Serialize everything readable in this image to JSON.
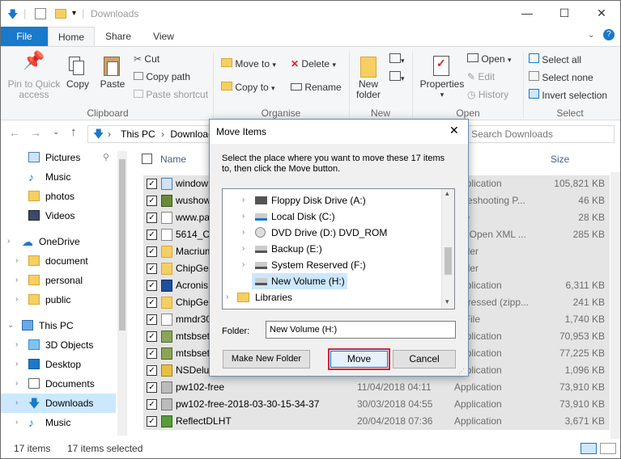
{
  "window": {
    "title": "Downloads",
    "min": "—",
    "max": "☐",
    "close": "✕"
  },
  "tabs": {
    "file": "File",
    "home": "Home",
    "share": "Share",
    "view": "View"
  },
  "ribbon": {
    "pin": "Pin to Quick access",
    "copy": "Copy",
    "paste": "Paste",
    "cut": "Cut",
    "copy_path": "Copy path",
    "paste_shortcut": "Paste shortcut",
    "clipboard": "Clipboard",
    "move_to": "Move to",
    "copy_to": "Copy to",
    "delete": "Delete",
    "rename": "Rename",
    "organise": "Organise",
    "new_folder": "New folder",
    "new": "New",
    "properties": "Properties",
    "open_btn": "Open",
    "edit": "Edit",
    "history": "History",
    "open_grp": "Open",
    "select_all": "Select all",
    "select_none": "Select none",
    "invert": "Invert selection",
    "select": "Select"
  },
  "nav": {
    "path_root": "This PC",
    "path_sep": "›",
    "path_current": "Downloads",
    "search_placeholder": "Search Downloads"
  },
  "sidebar": {
    "items": [
      {
        "label": "Pictures"
      },
      {
        "label": "Music"
      },
      {
        "label": "photos"
      },
      {
        "label": "Videos"
      },
      {
        "label": "OneDrive"
      },
      {
        "label": "document"
      },
      {
        "label": "personal"
      },
      {
        "label": "public"
      },
      {
        "label": "This PC"
      },
      {
        "label": "3D Objects"
      },
      {
        "label": "Desktop"
      },
      {
        "label": "Documents"
      },
      {
        "label": "Downloads"
      },
      {
        "label": "Music"
      }
    ]
  },
  "columns": {
    "name": "Name",
    "size": "Size"
  },
  "files": [
    {
      "name": "window",
      "date": "",
      "type": "Application",
      "size": "105,821 KB"
    },
    {
      "name": "wushow",
      "date": "",
      "type": "ubleshooting P...",
      "size": "46 KB"
    },
    {
      "name": "www.pa",
      "date": "",
      "type": "File",
      "size": "28 KB"
    },
    {
      "name": "5614_Cr",
      "date": "",
      "type": "ice Open XML ...",
      "size": "285 KB"
    },
    {
      "name": "Macrium",
      "date": "",
      "type": "folder",
      "size": ""
    },
    {
      "name": "ChipGen",
      "date": "",
      "type": "folder",
      "size": ""
    },
    {
      "name": "Acronis",
      "date": "",
      "type": "Application",
      "size": "6,311 KB"
    },
    {
      "name": "ChipGen",
      "date": "",
      "type": "mpressed (zipp...",
      "size": "241 KB"
    },
    {
      "name": "mmdr30",
      "date": "",
      "type": "G File",
      "size": "1,740 KB"
    },
    {
      "name": "mtsbset",
      "date": "",
      "type": "Application",
      "size": "70,953 KB"
    },
    {
      "name": "mtsbset",
      "date": "",
      "type": "Application",
      "size": "77,225 KB"
    },
    {
      "name": "NSDelux",
      "date": "",
      "type": "Application",
      "size": "1,096 KB"
    },
    {
      "name": "pw102-free",
      "date": "11/04/2018 04:11",
      "type": "Application",
      "size": "73,910 KB"
    },
    {
      "name": "pw102-free-2018-03-30-15-34-37",
      "date": "30/03/2018 04:55",
      "type": "Application",
      "size": "73,910 KB"
    },
    {
      "name": "ReflectDLHT",
      "date": "20/04/2018 07:36",
      "type": "Application",
      "size": "3,671 KB"
    }
  ],
  "status": {
    "count": "17 items",
    "selected": "17 items selected"
  },
  "dialog": {
    "title": "Move Items",
    "instruction": "Select the place where you want to move these 17 items to, then click the Move button.",
    "tree": [
      {
        "label": "Floppy Disk Drive (A:)"
      },
      {
        "label": "Local Disk (C:)"
      },
      {
        "label": "DVD Drive (D:) DVD_ROM"
      },
      {
        "label": "Backup (E:)"
      },
      {
        "label": "System Reserved (F:)"
      },
      {
        "label": "New Volume (H:)"
      },
      {
        "label": "Libraries"
      }
    ],
    "folder_label": "Folder:",
    "folder_value": "New Volume (H:)",
    "make_new_folder": "Make New Folder",
    "move": "Move",
    "cancel": "Cancel"
  },
  "colors": {
    "accent": "#1979ca",
    "selected": "#cce8ff",
    "highlight": "#d8202f"
  }
}
